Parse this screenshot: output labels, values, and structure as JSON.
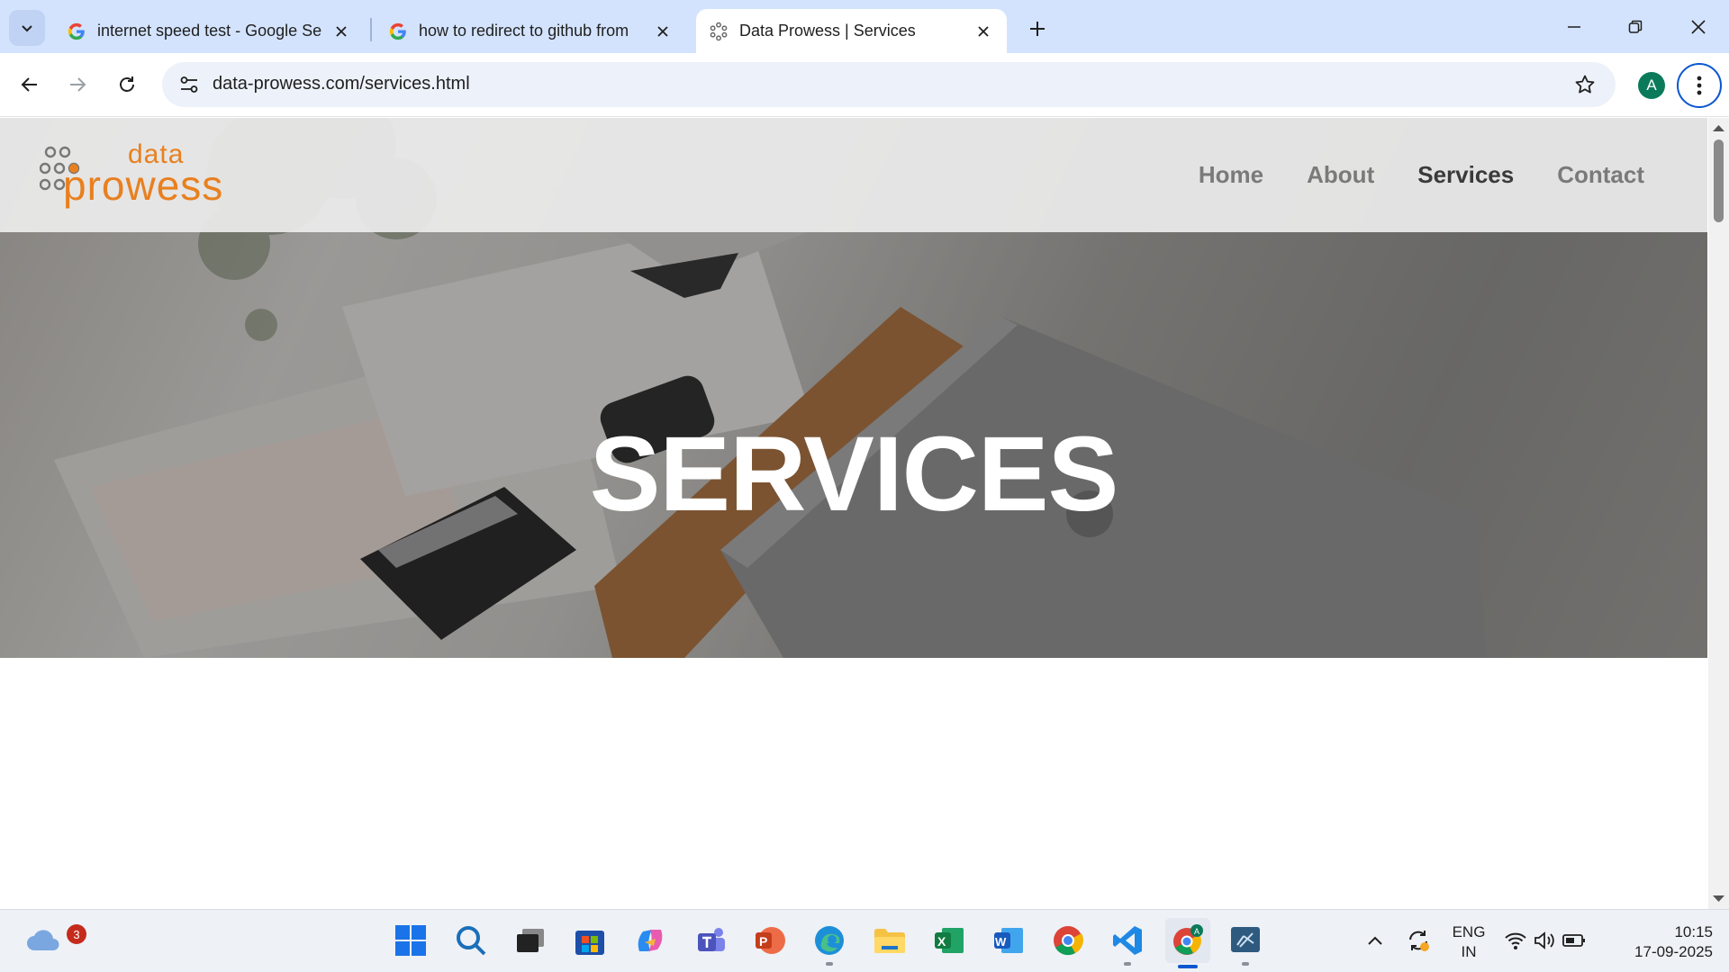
{
  "browser": {
    "tabs": [
      {
        "title": "internet speed test - Google Se",
        "icon": "google-icon",
        "active": false
      },
      {
        "title": "how to redirect to github from",
        "icon": "google-icon",
        "active": false
      },
      {
        "title": "Data Prowess | Services",
        "icon": "site-favicon",
        "active": true
      }
    ],
    "url": "data-prowess.com/services.html",
    "profile_initial": "A"
  },
  "site": {
    "logo": {
      "word1": "data",
      "word2": "prowess"
    },
    "nav": [
      "Home",
      "About",
      "Services",
      "Contact"
    ],
    "current_nav": "Services",
    "hero_title": "SERVICES",
    "accent_color": "#e8801f"
  },
  "taskbar": {
    "weather_badge": "3",
    "apps": [
      "start-icon",
      "search-icon",
      "task-view-icon",
      "store-icon",
      "copilot-icon",
      "teams-icon",
      "powerpoint-icon",
      "edge-icon",
      "file-explorer-icon",
      "excel-icon",
      "word-icon",
      "chrome-icon",
      "vscode-icon",
      "chrome-profile-icon",
      "remote-desktop-icon"
    ],
    "language": "ENG",
    "region": "IN",
    "time": "10:15",
    "date": "17-09-2025"
  }
}
